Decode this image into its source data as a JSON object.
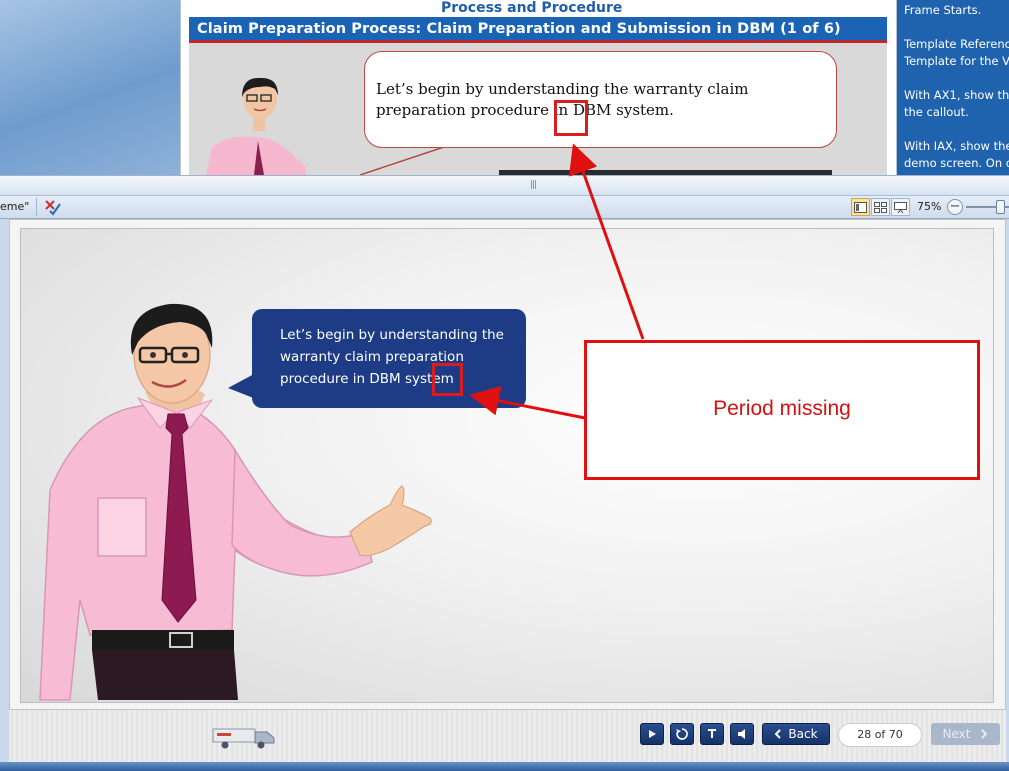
{
  "document": {
    "heading": "Process and Procedure",
    "slide_title": "Claim Preparation Process: Claim Preparation and Submission in DBM (1 of 6)",
    "callout_text": "Let’s begin by understanding  the  warranty claim preparation procedure in DBM system."
  },
  "notes": {
    "lines": [
      "Frame Starts.",
      "",
      "Template Referenc",
      "Template for the V",
      "",
      "With AX1, show th",
      "the callout.",
      "",
      "With IAX, show the",
      "demo screen. On c"
    ]
  },
  "toolbar": {
    "theme_label": "eme\"",
    "zoom_level": "75%"
  },
  "slide": {
    "bubble_text": "Let’s begin by understanding the warranty claim preparation procedure in DBM system"
  },
  "annotation": {
    "text": "Period missing"
  },
  "nav": {
    "back_label": "Back",
    "page_counter": "28 of 70",
    "next_label": "Next"
  },
  "colors": {
    "annotation_red": "#e01010",
    "bubble_navy": "#1d3c85",
    "slide_title_bar": "#1a63b5"
  }
}
